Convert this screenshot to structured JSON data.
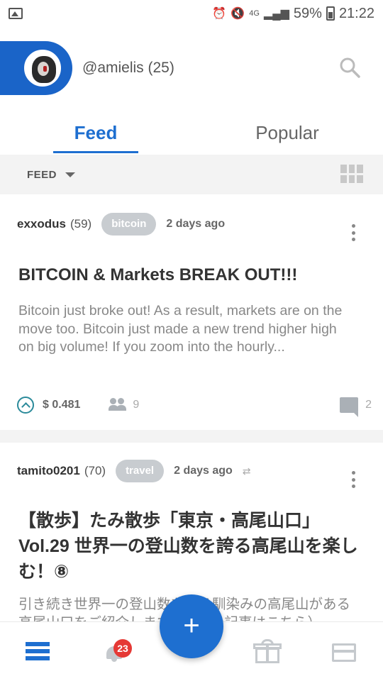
{
  "status_bar": {
    "network": "4G",
    "battery": "59%",
    "time": "21:22"
  },
  "header": {
    "username": "@amielis (25)"
  },
  "tabs": [
    {
      "label": "Feed",
      "active": true
    },
    {
      "label": "Popular",
      "active": false
    }
  ],
  "filter": {
    "label": "FEED"
  },
  "posts": [
    {
      "author": "exxodus",
      "reputation": "(59)",
      "tag": "bitcoin",
      "time": "2 days ago",
      "title": "BITCOIN & Markets BREAK OUT!!!",
      "body": "Bitcoin just broke out! As a result, markets are on the move too. Bitcoin just made a new trend higher high on big volume! If you zoom into the hourly...",
      "payout": "$ 0.481",
      "voters": "9",
      "comments": "2"
    },
    {
      "author": "tamito0201",
      "reputation": "(70)",
      "tag": "travel",
      "time": "2 days ago",
      "title": "【散歩】たみ散歩「東京・高尾山口」Vol.29 世界一の登山数を誇る高尾山を楽しむ！⑧",
      "body": "引き続き世界一の登山数を誇る馴染みの高尾山がある高尾山口をご紹介します。前回の記事はこちら）"
    }
  ],
  "bottom_nav": {
    "notification_count": "23",
    "fab_label": "+"
  },
  "colors": {
    "accent": "#1e6fd0",
    "tag_bg": "#c8ccd0",
    "badge": "#e53935"
  }
}
